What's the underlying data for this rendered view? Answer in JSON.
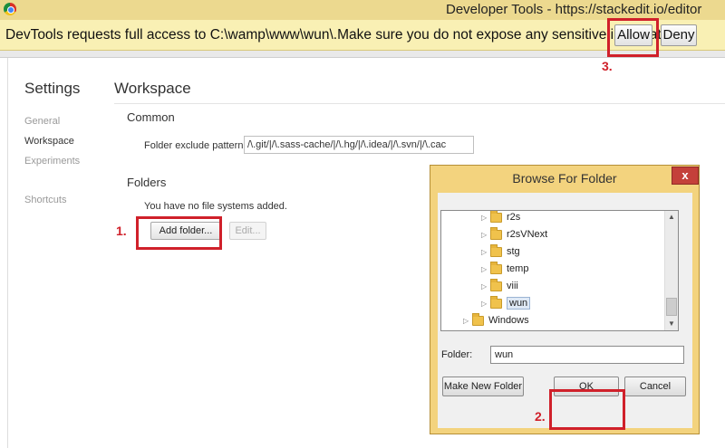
{
  "window": {
    "title": "Developer Tools - https://stackedit.io/editor"
  },
  "infobar": {
    "message": "DevTools requests full access to C:\\wamp\\www\\wun\\.Make sure you do not expose any sensitive information.",
    "allow_label": "Allow",
    "deny_label": "Deny"
  },
  "settings": {
    "title": "Settings",
    "nav": [
      "General",
      "Workspace",
      "Experiments",
      "Shortcuts"
    ],
    "active_nav": "Workspace",
    "section_title": "Workspace",
    "common_heading": "Common",
    "exclude_label": "Folder exclude pattern",
    "exclude_value": "/\\.git/|/\\.sass-cache/|/\\.hg/|/\\.idea/|/\\.svn/|/\\.cac",
    "folders_heading": "Folders",
    "no_fs_text": "You have no file systems added.",
    "add_folder_label": "Add folder...",
    "edit_label": "Edit..."
  },
  "dialog": {
    "title": "Browse For Folder",
    "close_label": "x",
    "tree": [
      {
        "label": "r2s",
        "selected": false
      },
      {
        "label": "r2sVNext",
        "selected": false
      },
      {
        "label": "stg",
        "selected": false
      },
      {
        "label": "temp",
        "selected": false
      },
      {
        "label": "viii",
        "selected": false
      },
      {
        "label": "wun",
        "selected": true
      },
      {
        "label": "Windows",
        "selected": false
      }
    ],
    "folder_label": "Folder:",
    "folder_value": "wun",
    "make_new_folder_label": "Make New Folder",
    "ok_label": "OK",
    "cancel_label": "Cancel"
  },
  "annotations": {
    "step1": "1.",
    "step2": "2.",
    "step3": "3."
  },
  "colors": {
    "annotation": "#d0202a",
    "infobar_bg": "#f9f0b4",
    "titlebar_bg": "#ecd98f",
    "dialog_frame": "#f3d37e"
  }
}
